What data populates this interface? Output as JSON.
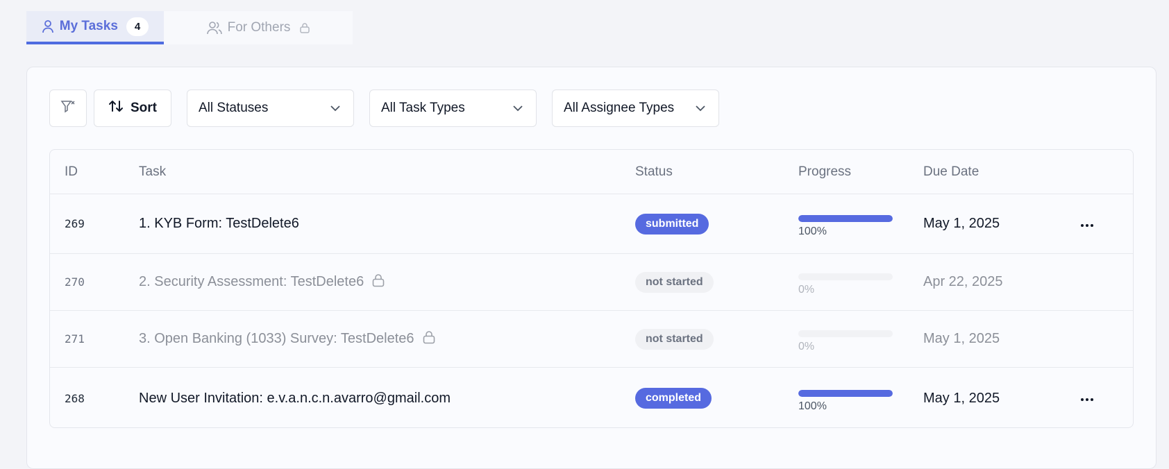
{
  "tabs": {
    "my_tasks": {
      "label": "My Tasks",
      "count": "4"
    },
    "for_others": {
      "label": "For Others"
    }
  },
  "toolbar": {
    "sort_label": "Sort",
    "status_select": "All Statuses",
    "task_type_select": "All Task Types",
    "assignee_select": "All Assignee Types"
  },
  "table": {
    "headers": {
      "id": "ID",
      "task": "Task",
      "status": "Status",
      "progress": "Progress",
      "due": "Due Date"
    },
    "rows": [
      {
        "id": "269",
        "task": "1. KYB Form: TestDelete6",
        "status": "submitted",
        "progress": 1.0,
        "progress_label": "100%",
        "due": "May 1, 2025"
      },
      {
        "id": "270",
        "task": "2. Security Assessment: TestDelete6",
        "status": "not started",
        "progress": 0.0,
        "progress_label": "0%",
        "due": "Apr 22, 2025"
      },
      {
        "id": "271",
        "task": "3. Open Banking (1033) Survey: TestDelete6",
        "status": "not started",
        "progress": 0.0,
        "progress_label": "0%",
        "due": "May 1, 2025"
      },
      {
        "id": "268",
        "task": "New User Invitation: e.v.a.n.c.n.avarro@gmail.com",
        "status": "completed",
        "progress": 1.0,
        "progress_label": "100%",
        "due": "May 1, 2025"
      }
    ]
  },
  "colors": {
    "accent": "#566ae0",
    "tab_active_bg": "#e9ecf7",
    "page_bg": "#f3f4f8"
  },
  "icons": [
    "user-icon",
    "users-icon",
    "lock-icon",
    "filter-clear-icon",
    "sort-arrows-icon",
    "chevron-down-icon",
    "more-horizontal-icon"
  ]
}
